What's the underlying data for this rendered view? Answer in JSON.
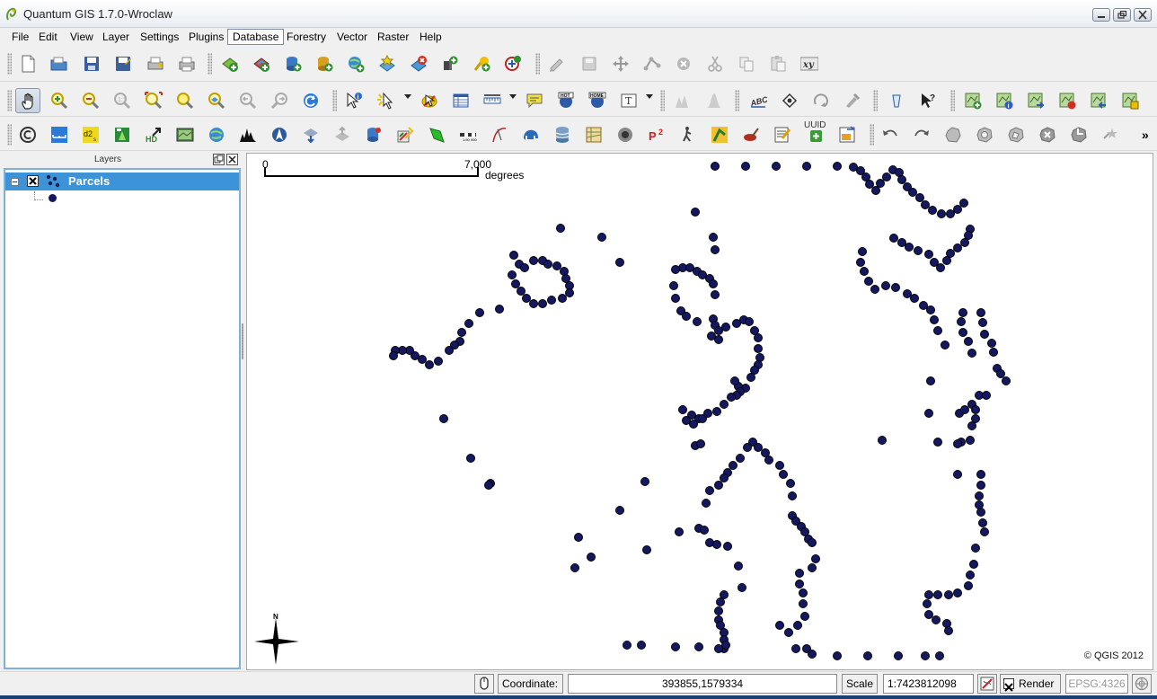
{
  "window": {
    "title": "Quantum GIS 1.7.0-Wroclaw",
    "controls": {
      "minimize": "minimize-icon",
      "maximize": "maximize-icon",
      "close": "close-icon"
    }
  },
  "menu": {
    "items": [
      "File",
      "Edit",
      "View",
      "Layer",
      "Settings",
      "Plugins",
      "Database",
      "Forestry",
      "Vector",
      "Raster",
      "Help"
    ],
    "active": "Database"
  },
  "toolbar": {
    "uuid_label": "UUID",
    "pan_tool_active": true
  },
  "layers_panel": {
    "title": "Layers",
    "layers": [
      {
        "name": "Parcels",
        "visible": true,
        "geometry": "point",
        "symbol_color": "#141860"
      }
    ]
  },
  "map": {
    "scale_bar": {
      "start": "0",
      "end": "7,000",
      "unit": "degrees"
    },
    "north_arrow": "N",
    "copyright": "© QGIS 2012",
    "point_color": "#141860",
    "point_stroke": "#000000"
  },
  "status": {
    "coordinate_label": "Coordinate:",
    "coordinate_value": "393855,1579334",
    "scale_label": "Scale",
    "scale_value": "1:7423812098",
    "render_label": "Render",
    "render_checked": true,
    "crs": "EPSG:4326"
  },
  "colors": {
    "selection": "#3d93d8",
    "panel_border": "#7fb0dc"
  }
}
